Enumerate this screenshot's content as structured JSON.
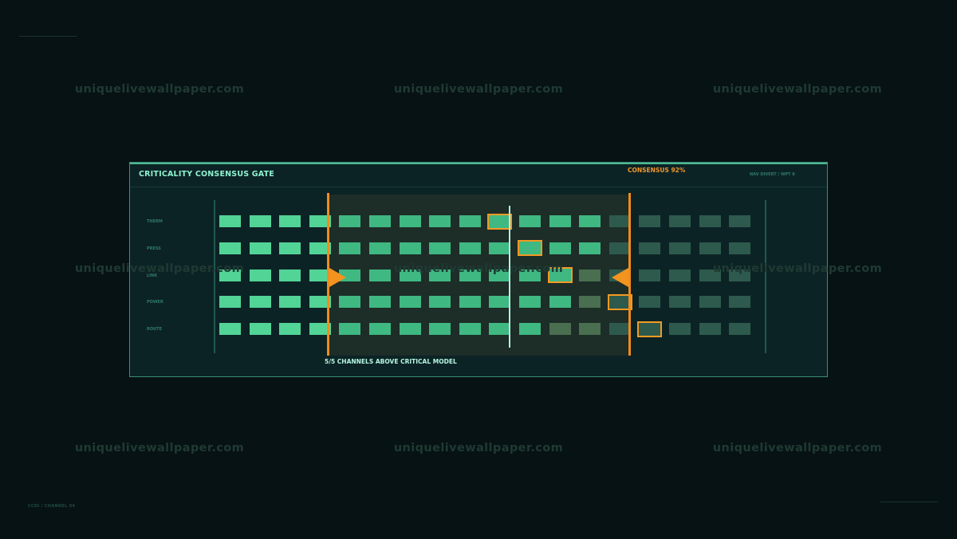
{
  "watermark_text": "uniquelivewallpaper.com",
  "corner_label": "CCDI / CHANNEL 04",
  "panel": {
    "title": "CRITICALITY CONSENSUS GATE",
    "consensus_label": "CONSENSUS 92%",
    "nav_label": "NAV DIVERT / WPT 8",
    "footer_label": "5/5 CHANNELS ABOVE CRITICAL MODEL"
  },
  "rows": [
    {
      "label": "THERM",
      "above_count": 13,
      "selected_index": 9
    },
    {
      "label": "PRESS",
      "above_count": 13,
      "selected_index": 10
    },
    {
      "label": "LINK",
      "above_count": 12,
      "selected_index": 11
    },
    {
      "label": "POWER",
      "above_count": 12,
      "selected_index": 13
    },
    {
      "label": "ROUTE",
      "above_count": 11,
      "selected_index": 14
    }
  ],
  "cells_per_row": 18,
  "colors": {
    "cell_active": "#52d496",
    "cell_active_dim": "#3fb882",
    "cell_below": "#4a6e50",
    "cell_outside": "#2d5a4c",
    "gate": "#f28c1c",
    "highlight": "#f39a23",
    "accent_text": "#8ff2cf"
  }
}
